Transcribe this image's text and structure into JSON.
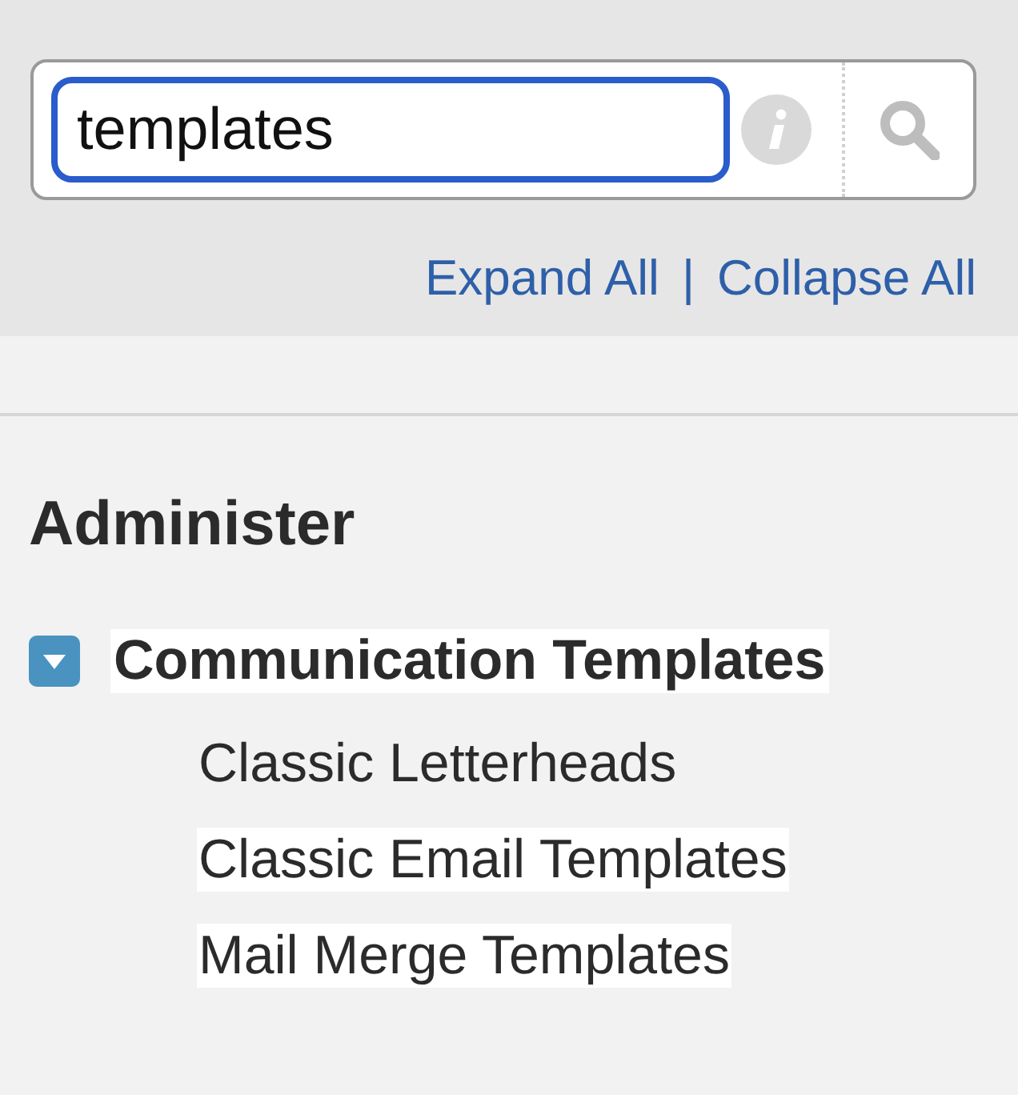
{
  "search": {
    "value": "templates",
    "focused": true
  },
  "links": [
    {
      "label": "Expand All"
    },
    {
      "label": "Collapse All"
    }
  ],
  "link_separator": "|",
  "section": {
    "title": "Administer",
    "tree": [
      {
        "label": "Communication Templates",
        "expanded": true,
        "highlighted": true,
        "children": [
          {
            "label": "Classic Letterheads",
            "highlighted": false
          },
          {
            "label": "Classic Email Templates",
            "highlighted": true
          },
          {
            "label": "Mail Merge Templates",
            "highlighted": true
          }
        ]
      }
    ]
  }
}
